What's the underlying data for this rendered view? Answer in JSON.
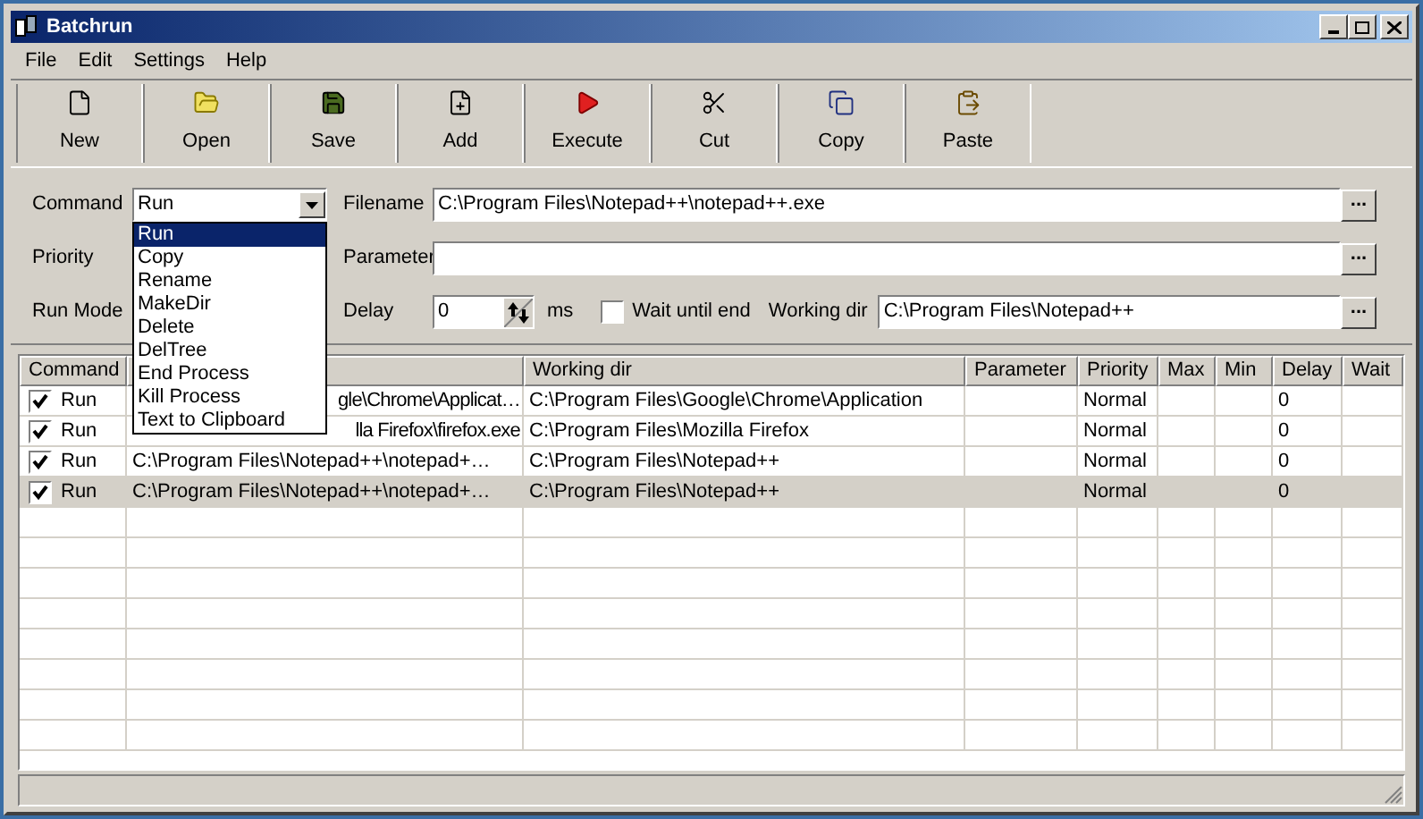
{
  "window": {
    "title": "Batchrun"
  },
  "menu": [
    "File",
    "Edit",
    "Settings",
    "Help"
  ],
  "toolbar": [
    {
      "label": "New",
      "kind": "new"
    },
    {
      "label": "Open",
      "kind": "open"
    },
    {
      "label": "Save",
      "kind": "save"
    },
    {
      "label": "Add",
      "kind": "add"
    },
    {
      "label": "Execute",
      "kind": "execute"
    },
    {
      "label": "Cut",
      "kind": "cut"
    },
    {
      "label": "Copy",
      "kind": "copy"
    },
    {
      "label": "Paste",
      "kind": "paste"
    }
  ],
  "form": {
    "command": {
      "label": "Command",
      "value": "Run",
      "expanded": true,
      "options": [
        {
          "label": "Run",
          "selected": true
        },
        {
          "label": "Copy",
          "selected": false
        },
        {
          "label": "Rename",
          "selected": false
        },
        {
          "label": "MakeDir",
          "selected": false
        },
        {
          "label": "Delete",
          "selected": false
        },
        {
          "label": "DelTree",
          "selected": false
        },
        {
          "label": "End Process",
          "selected": false
        },
        {
          "label": "Kill Process",
          "selected": false
        },
        {
          "label": "Text to Clipboard",
          "selected": false
        }
      ]
    },
    "filename": {
      "label": "Filename",
      "value": "C:\\Program Files\\Notepad++\\notepad++.exe",
      "browse": "..."
    },
    "priority": {
      "label": "Priority"
    },
    "parameter": {
      "label": "Parameter",
      "browse": "..."
    },
    "run_mode": {
      "label": "Run Mode"
    },
    "delay": {
      "label": "Delay",
      "value": "0",
      "unit": "ms"
    },
    "wait_until_end": {
      "label": "Wait until end",
      "checked": false
    },
    "working_dir": {
      "label": "Working dir",
      "value": "C:\\Program Files\\Notepad++",
      "browse": "..."
    }
  },
  "table": {
    "columns": [
      {
        "kind": "text",
        "label": "Command"
      },
      {
        "kind": "blank"
      },
      {
        "kind": "text",
        "label": "Working dir"
      },
      {
        "kind": "text",
        "label": "Parameter"
      },
      {
        "kind": "text",
        "label": "Priority"
      },
      {
        "kind": "text",
        "label": "Max"
      },
      {
        "kind": "text",
        "label": "Min"
      },
      {
        "kind": "text",
        "label": "Delay"
      },
      {
        "kind": "text",
        "label": "Wait"
      }
    ],
    "rows": [
      {
        "checked": true,
        "command": "Run",
        "filename": "gle\\Chrome\\Applicat…",
        "filename_partial": true,
        "working_dir": "C:\\Program Files\\Google\\Chrome\\Application",
        "priority": "Normal",
        "delay": "0",
        "selected": false
      },
      {
        "checked": true,
        "command": "Run",
        "filename": "lla Firefox\\firefox.exe",
        "filename_partial": true,
        "working_dir": "C:\\Program Files\\Mozilla Firefox",
        "priority": "Normal",
        "delay": "0",
        "selected": false
      },
      {
        "checked": true,
        "command": "Run",
        "filename": "C:\\Program Files\\Notepad++\\notepad+…",
        "filename_partial": false,
        "working_dir": "C:\\Program Files\\Notepad++",
        "priority": "Normal",
        "delay": "0",
        "selected": false
      },
      {
        "checked": true,
        "command": "Run",
        "filename": "C:\\Program Files\\Notepad++\\notepad+…",
        "filename_partial": false,
        "working_dir": "C:\\Program Files\\Notepad++",
        "priority": "Normal",
        "delay": "0",
        "selected": true
      }
    ]
  }
}
